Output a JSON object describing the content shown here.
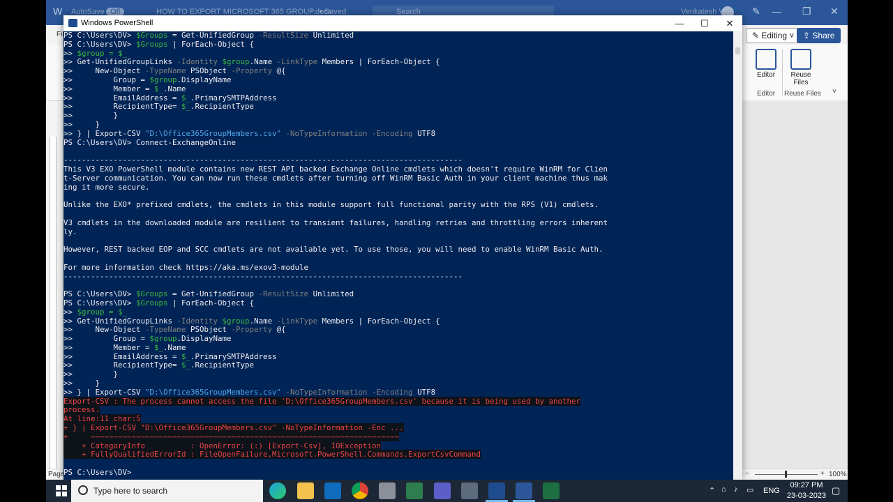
{
  "word": {
    "autosave": "AutoSave",
    "autosave_state": "Off",
    "doc_title": "HOW TO EXPORT MICROSOFT 365 GROUP.docx",
    "saved": "• Saved",
    "search": "Search",
    "user": "Venkatesh V",
    "file_tab": "File",
    "editing_label": "Editing",
    "share_label": "Share",
    "editor_label": "Editor",
    "reuse_files_line1": "Reuse",
    "reuse_files_line2": "Files",
    "editor_group": "Editor",
    "reuse_group": "Reuse Files",
    "page_label": "Page",
    "zoom": "100%"
  },
  "powershell": {
    "title": "Windows PowerShell",
    "minimize": "—",
    "maximize": "☐",
    "close": "✕",
    "lines": [
      [
        {
          "t": "PS C:\\Users\\DV> "
        },
        {
          "t": "$Groups",
          "c": "t-var"
        },
        {
          "t": " = Get-UnifiedGroup "
        },
        {
          "t": "-ResultSize",
          "c": "t-param"
        },
        {
          "t": " Unlimited"
        }
      ],
      [
        {
          "t": "PS C:\\Users\\DV> "
        },
        {
          "t": "$Groups",
          "c": "t-var"
        },
        {
          "t": " | ForEach-Object {"
        }
      ],
      [
        {
          "t": ">> "
        },
        {
          "t": "$group = $_",
          "c": "t-var"
        }
      ],
      [
        {
          "t": ">> Get-UnifiedGroupLinks "
        },
        {
          "t": "-Identity",
          "c": "t-param"
        },
        {
          "t": " "
        },
        {
          "t": "$group",
          "c": "t-var"
        },
        {
          "t": ".Name "
        },
        {
          "t": "-LinkType",
          "c": "t-param"
        },
        {
          "t": " Members | ForEach-Object {"
        }
      ],
      [
        {
          "t": ">>     New-Object "
        },
        {
          "t": "-TypeName",
          "c": "t-param"
        },
        {
          "t": " PSObject "
        },
        {
          "t": "-Property",
          "c": "t-param"
        },
        {
          "t": " @{"
        }
      ],
      [
        {
          "t": ">>         Group = "
        },
        {
          "t": "$group",
          "c": "t-var"
        },
        {
          "t": ".DisplayName"
        }
      ],
      [
        {
          "t": ">>         Member = "
        },
        {
          "t": "$_",
          "c": "t-var"
        },
        {
          "t": ".Name"
        }
      ],
      [
        {
          "t": ">>         EmailAddress = "
        },
        {
          "t": "$_",
          "c": "t-var"
        },
        {
          "t": ".PrimarySMTPAddress"
        }
      ],
      [
        {
          "t": ">>         RecipientType= "
        },
        {
          "t": "$_",
          "c": "t-var"
        },
        {
          "t": ".RecipientType"
        }
      ],
      [
        {
          "t": ">>         }"
        }
      ],
      [
        {
          "t": ">>     }"
        }
      ],
      [
        {
          "t": ">> } | Export-CSV "
        },
        {
          "t": "\"D:\\Office365GroupMembers.csv\"",
          "c": "t-str"
        },
        {
          "t": " "
        },
        {
          "t": "-NoTypeInformation -Encoding",
          "c": "t-param"
        },
        {
          "t": " UTF8"
        }
      ],
      [
        {
          "t": "PS C:\\Users\\DV> Connect-ExchangeOnline"
        }
      ],
      [
        {
          "t": ""
        }
      ],
      [
        {
          "t": "----------------------------------------------------------------------------------------"
        }
      ],
      [
        {
          "t": "This V3 EXO PowerShell module contains new REST API backed Exchange Online cmdlets which doesn't require WinRM for Clien"
        }
      ],
      [
        {
          "t": "t-Server communication. You can now run these cmdlets after turning off WinRM Basic Auth in your client machine thus mak"
        }
      ],
      [
        {
          "t": "ing it more secure."
        }
      ],
      [
        {
          "t": ""
        }
      ],
      [
        {
          "t": "Unlike the EXO* prefixed cmdlets, the cmdlets in this module support full functional parity with the RPS (V1) cmdlets."
        }
      ],
      [
        {
          "t": ""
        }
      ],
      [
        {
          "t": "V3 cmdlets in the downloaded module are resilient to transient failures, handling retries and throttling errors inherent"
        }
      ],
      [
        {
          "t": "ly."
        }
      ],
      [
        {
          "t": ""
        }
      ],
      [
        {
          "t": "However, REST backed EOP and SCC cmdlets are not available yet. To use those, you will need to enable WinRM Basic Auth."
        }
      ],
      [
        {
          "t": ""
        }
      ],
      [
        {
          "t": "For more information check https://aka.ms/exov3-module"
        }
      ],
      [
        {
          "t": "----------------------------------------------------------------------------------------"
        }
      ],
      [
        {
          "t": ""
        }
      ],
      [
        {
          "t": "PS C:\\Users\\DV> "
        },
        {
          "t": "$Groups",
          "c": "t-var"
        },
        {
          "t": " = Get-UnifiedGroup "
        },
        {
          "t": "-ResultSize",
          "c": "t-param"
        },
        {
          "t": " Unlimited"
        }
      ],
      [
        {
          "t": "PS C:\\Users\\DV> "
        },
        {
          "t": "$Groups",
          "c": "t-var"
        },
        {
          "t": " | ForEach-Object {"
        }
      ],
      [
        {
          "t": ">> "
        },
        {
          "t": "$group = $_",
          "c": "t-var"
        }
      ],
      [
        {
          "t": ">> Get-UnifiedGroupLinks "
        },
        {
          "t": "-Identity",
          "c": "t-param"
        },
        {
          "t": " "
        },
        {
          "t": "$group",
          "c": "t-var"
        },
        {
          "t": ".Name "
        },
        {
          "t": "-LinkType",
          "c": "t-param"
        },
        {
          "t": " Members | ForEach-Object {"
        }
      ],
      [
        {
          "t": ">>     New-Object "
        },
        {
          "t": "-TypeName",
          "c": "t-param"
        },
        {
          "t": " PSObject "
        },
        {
          "t": "-Property",
          "c": "t-param"
        },
        {
          "t": " @{"
        }
      ],
      [
        {
          "t": ">>         Group = "
        },
        {
          "t": "$group",
          "c": "t-var"
        },
        {
          "t": ".DisplayName"
        }
      ],
      [
        {
          "t": ">>         Member = "
        },
        {
          "t": "$_",
          "c": "t-var"
        },
        {
          "t": ".Name"
        }
      ],
      [
        {
          "t": ">>         EmailAddress = "
        },
        {
          "t": "$_",
          "c": "t-var"
        },
        {
          "t": ".PrimarySMTPAddress"
        }
      ],
      [
        {
          "t": ">>         RecipientType= "
        },
        {
          "t": "$_",
          "c": "t-var"
        },
        {
          "t": ".RecipientType"
        }
      ],
      [
        {
          "t": ">>         }"
        }
      ],
      [
        {
          "t": ">>     }"
        }
      ],
      [
        {
          "t": ">> } | Export-CSV "
        },
        {
          "t": "\"D:\\Office365GroupMembers.csv\"",
          "c": "t-str"
        },
        {
          "t": " "
        },
        {
          "t": "-NoTypeInformation -Encoding",
          "c": "t-param"
        },
        {
          "t": " UTF8"
        }
      ],
      [
        {
          "t": "Export-CSV : The process cannot access the file 'D:\\Office365GroupMembers.csv' because it is being used by another",
          "c": "t-err t-sel"
        }
      ],
      [
        {
          "t": "process.",
          "c": "t-err t-sel"
        }
      ],
      [
        {
          "t": "At line:11 char:5",
          "c": "t-err t-sel"
        }
      ],
      [
        {
          "t": "+ } | Export-CSV \"D:\\Office365GroupMembers.csv\" -NoTypeInformation -Enc ...",
          "c": "t-err t-sel"
        }
      ],
      [
        {
          "t": "+     ~~~~~~~~~~~~~~~~~~~~~~~~~~~~~~~~~~~~~~~~~~~~~~~~~~~~~~~~~~~~~~~~~~~~",
          "c": "t-err t-sel"
        }
      ],
      [
        {
          "t": "    + CategoryInfo          : OpenError: (:) [Export-Csv], IOException",
          "c": "t-err t-sel"
        }
      ],
      [
        {
          "t": "    + FullyQualifiedErrorId : FileOpenFailure,Microsoft.PowerShell.Commands.ExportCsvCommand",
          "c": "t-err t-sel"
        }
      ],
      [
        {
          "t": ""
        }
      ],
      [
        {
          "t": "PS C:\\Users\\DV> "
        }
      ]
    ]
  },
  "taskbar": {
    "search_placeholder": "Type here to search",
    "language": "ENG",
    "time": "09:27 PM",
    "date": "23-03-2023"
  },
  "colors": {
    "ps_background": "#012456",
    "ps_text": "#eeedf0",
    "ps_variable": "#3ab840",
    "ps_parameter": "#7f7f7f",
    "ps_string": "#53a6e6",
    "ps_error": "#e84545",
    "word_brand": "#2b579a",
    "taskbar": "#1c2837"
  }
}
